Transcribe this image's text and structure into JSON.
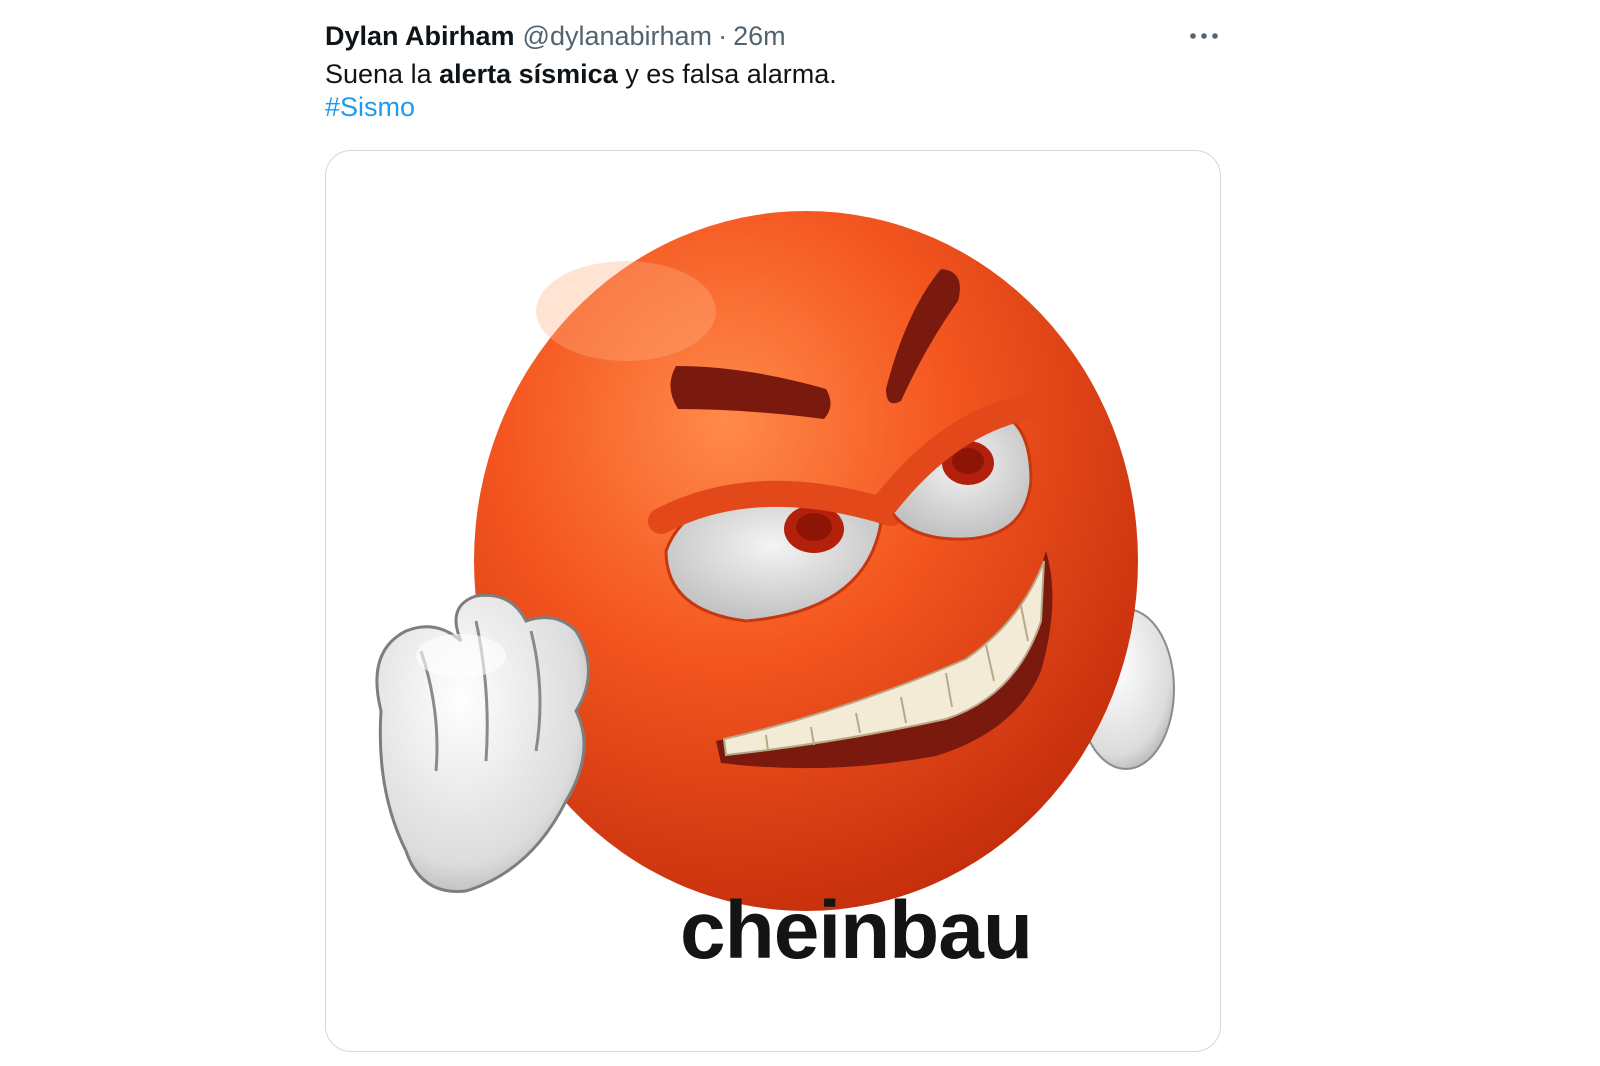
{
  "tweet": {
    "author_name": "Dylan Abirham",
    "author_handle": "@dylanabirham",
    "separator": "·",
    "timestamp": "26m",
    "more_icon": "more-horizontal-icon",
    "text_part1": "Suena la ",
    "text_bold": "alerta sísmica",
    "text_part2": " y es falsa alarma.",
    "hashtag": "#Sismo",
    "colors": {
      "text": "#0f1419",
      "secondary": "#536471",
      "link": "#1d9bf0",
      "border": "#cfd9de"
    }
  },
  "media": {
    "type": "meme-image",
    "subject": "angry-orange-emoji",
    "caption": "cheinbau",
    "colors": {
      "face": "#f2531f",
      "brow": "#7a1a0e",
      "glove": "#e8e8e8"
    }
  }
}
